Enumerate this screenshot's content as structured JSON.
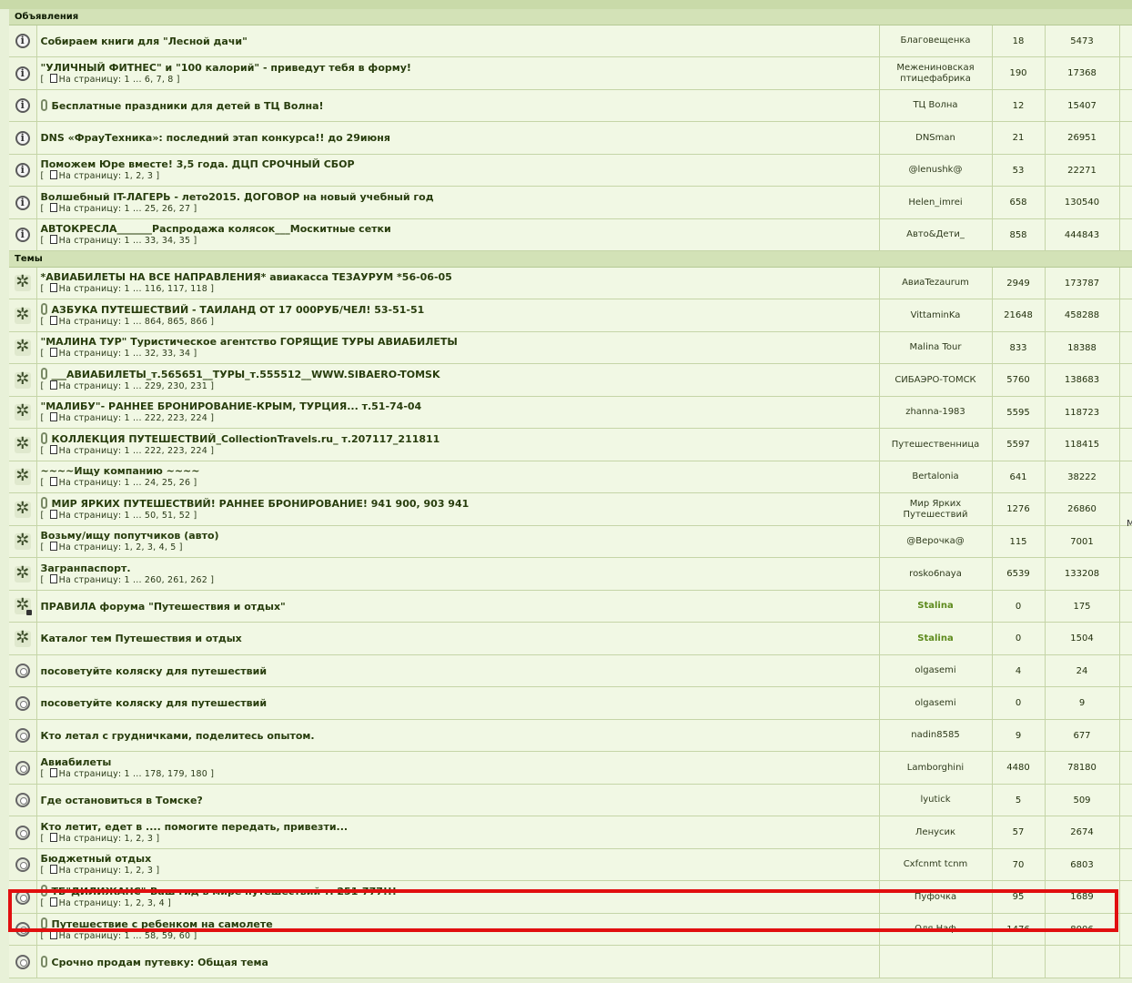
{
  "sections": [
    {
      "title": "Объявления",
      "rows": [
        {
          "icon": "info",
          "attach": false,
          "title": "Собираем книги для \"Лесной дачи\"",
          "pages": "",
          "author": "Благовещенка",
          "author2": "",
          "replies": "18",
          "views": "5473"
        },
        {
          "icon": "info",
          "attach": false,
          "title": "\"УЛИЧНЫЙ ФИТНЕС\" и \"100 калорий\" - приведут тебя в форму!",
          "pages": "1 ... 6, 7, 8",
          "author": "Межениновская",
          "author2": "птицефабрика",
          "replies": "190",
          "views": "17368"
        },
        {
          "icon": "info",
          "attach": true,
          "title": "Бесплатные праздники для детей в ТЦ Волна!",
          "pages": "",
          "author": "ТЦ Волна",
          "author2": "",
          "replies": "12",
          "views": "15407"
        },
        {
          "icon": "info",
          "attach": false,
          "title": "DNS «ФрауТехника»: последний этап конкурса!! до 29июня",
          "pages": "",
          "author": "DNSman",
          "author2": "",
          "replies": "21",
          "views": "26951"
        },
        {
          "icon": "info",
          "attach": false,
          "title": "Поможем Юре вместе! 3,5 года. ДЦП СРОЧНЫЙ СБОР",
          "pages": "1, 2, 3",
          "author": "@lenushk@",
          "author2": "",
          "replies": "53",
          "views": "22271"
        },
        {
          "icon": "info",
          "attach": false,
          "title": "Волшебный IT-ЛАГЕРЬ - лето2015. ДОГОВОР на новый учебный год",
          "pages": "1 ... 25, 26, 27",
          "author": "Helen_imrei",
          "author2": "",
          "replies": "658",
          "views": "130540"
        },
        {
          "icon": "info",
          "attach": false,
          "title": "АВТОКРЕСЛА_______Распродажа колясок___Москитные сетки",
          "pages": "1 ... 33, 34, 35",
          "author": "Авто&Дети_",
          "author2": "",
          "replies": "858",
          "views": "444843"
        }
      ]
    },
    {
      "title": "Темы",
      "rows": [
        {
          "icon": "bolt",
          "attach": false,
          "title": "*АВИАБИЛЕТЫ НА ВСЕ НАПРАВЛЕНИЯ* авиакасса ТЕЗАУРУМ *56-06-05",
          "pages": "1 ... 116, 117, 118",
          "author": "АвиаTezaurum",
          "author2": "",
          "replies": "2949",
          "views": "173787"
        },
        {
          "icon": "bolt",
          "attach": true,
          "title": "АЗБУКА ПУТЕШЕСТВИЙ - ТАИЛАНД ОТ 17 000РУБ/ЧЕЛ! 53-51-51",
          "pages": "1 ... 864, 865, 866",
          "author": "VittaminKa",
          "author2": "",
          "replies": "21648",
          "views": "458288"
        },
        {
          "icon": "bolt",
          "attach": false,
          "title": "\"МАЛИНА ТУР\" Туристическое агентство ГОРЯЩИЕ ТУРЫ АВИАБИЛЕТЫ",
          "pages": "1 ... 32, 33, 34",
          "author": "Malina Tour",
          "author2": "",
          "replies": "833",
          "views": "18388"
        },
        {
          "icon": "bolt",
          "attach": true,
          "title": "___АВИАБИЛЕТЫ_т.565651__ТУРЫ_т.555512__WWW.SIBAERO-TOMSK",
          "pages": "1 ... 229, 230, 231",
          "author": "СИБАЭРО-ТОМСК",
          "author2": "",
          "replies": "5760",
          "views": "138683"
        },
        {
          "icon": "bolt",
          "attach": false,
          "title": "\"МАЛИБУ\"- РАННЕЕ БРОНИРОВАНИЕ-КРЫМ, ТУРЦИЯ... т.51-74-04",
          "pages": "1 ... 222, 223, 224",
          "author": "zhanna-1983",
          "author2": "",
          "replies": "5595",
          "views": "118723"
        },
        {
          "icon": "bolt",
          "attach": true,
          "title": "КОЛЛЕКЦИЯ ПУТЕШЕСТВИЙ_CollectionTravels.ru_ т.207117_211811",
          "pages": "1 ... 222, 223, 224",
          "author": "Путешественница",
          "author2": "",
          "replies": "5597",
          "views": "118415"
        },
        {
          "icon": "bolt",
          "attach": false,
          "title": "~~~~Ищу компанию ~~~~",
          "pages": "1 ... 24, 25, 26",
          "author": "Bertalonia",
          "author2": "",
          "replies": "641",
          "views": "38222"
        },
        {
          "icon": "bolt",
          "attach": true,
          "title": "МИР ЯРКИХ ПУТЕШЕСТВИЙ! РАННЕЕ БРОНИРОВАНИЕ! 941 900, 903 941",
          "pages": "1 ... 50, 51, 52",
          "author": "Мир Ярких",
          "author2": "Путешествий",
          "replies": "1276",
          "views": "26860"
        },
        {
          "icon": "bolt",
          "attach": false,
          "title": "Возьму/ищу попутчиков (авто)",
          "pages": "1, 2, 3, 4, 5",
          "author": "@Верочка@",
          "author2": "",
          "replies": "115",
          "views": "7001"
        },
        {
          "icon": "bolt",
          "attach": false,
          "title": "Загранпаспорт.",
          "pages": "1 ... 260, 261, 262",
          "author": "rosko6naya",
          "author2": "",
          "replies": "6539",
          "views": "133208"
        },
        {
          "icon": "bolt-lock",
          "attach": false,
          "title": "ПРАВИЛА форума \"Путешествия и отдых\"",
          "pages": "",
          "author": "Stalina",
          "author2": "",
          "replies": "0",
          "views": "175",
          "author_hl": true
        },
        {
          "icon": "bolt",
          "attach": false,
          "title": "Каталог тем Путешествия и отдых",
          "pages": "",
          "author": "Stalina",
          "author2": "",
          "replies": "0",
          "views": "1504",
          "author_hl": true
        },
        {
          "icon": "norm",
          "attach": false,
          "title": "посоветуйте коляску для путешествий",
          "pages": "",
          "author": "olgasemi",
          "author2": "",
          "replies": "4",
          "views": "24"
        },
        {
          "icon": "norm",
          "attach": false,
          "title": "посоветуйте коляску для путешествий",
          "pages": "",
          "author": "olgasemi",
          "author2": "",
          "replies": "0",
          "views": "9"
        },
        {
          "icon": "norm",
          "attach": false,
          "title": "Кто летал с грудничками, поделитесь опытом.",
          "pages": "",
          "author": "nadin8585",
          "author2": "",
          "replies": "9",
          "views": "677"
        },
        {
          "icon": "norm",
          "attach": false,
          "title": "Авиабилеты",
          "pages": "1 ... 178, 179, 180",
          "author": "Lamborghini",
          "author2": "",
          "replies": "4480",
          "views": "78180"
        },
        {
          "icon": "norm",
          "attach": false,
          "title": "Где остановиться в Томске?",
          "pages": "",
          "author": "lyutick",
          "author2": "",
          "replies": "5",
          "views": "509"
        },
        {
          "icon": "norm",
          "attach": false,
          "title": "Кто летит, едет в .... помогите передать, привезти...",
          "pages": "1, 2, 3",
          "author": "Ленусик",
          "author2": "",
          "replies": "57",
          "views": "2674"
        },
        {
          "icon": "norm",
          "attach": false,
          "title": "Бюджетный отдых",
          "pages": "1, 2, 3",
          "author": "Cxfcnmt tcnm",
          "author2": "",
          "replies": "70",
          "views": "6803"
        },
        {
          "icon": "norm",
          "attach": true,
          "title": "ТБ\"ДИЛИЖАНС\"-Ваш гид в мире путешествий т. 251-777!!!",
          "pages": "1, 2, 3, 4",
          "author": "Пуфочка",
          "author2": "",
          "replies": "95",
          "views": "1689"
        },
        {
          "icon": "norm",
          "attach": true,
          "title": "Путешествие с ребенком на самолете",
          "pages": "1 ... 58, 59, 60",
          "author": "Оля Наф",
          "author2": "",
          "replies": "1476",
          "views": "8006"
        },
        {
          "icon": "norm",
          "attach": true,
          "title": "Срочно продам путевку: Общая тема",
          "pages": "",
          "author": "",
          "author2": "",
          "replies": "",
          "views": ""
        }
      ]
    }
  ],
  "labels": {
    "pages_prefix": "На страницу:",
    "side_fragment": "M"
  },
  "colors": {
    "highlight": "#e10f0f",
    "row_bg": "#f1f8e4",
    "category_bg": "#d3e2b7"
  }
}
